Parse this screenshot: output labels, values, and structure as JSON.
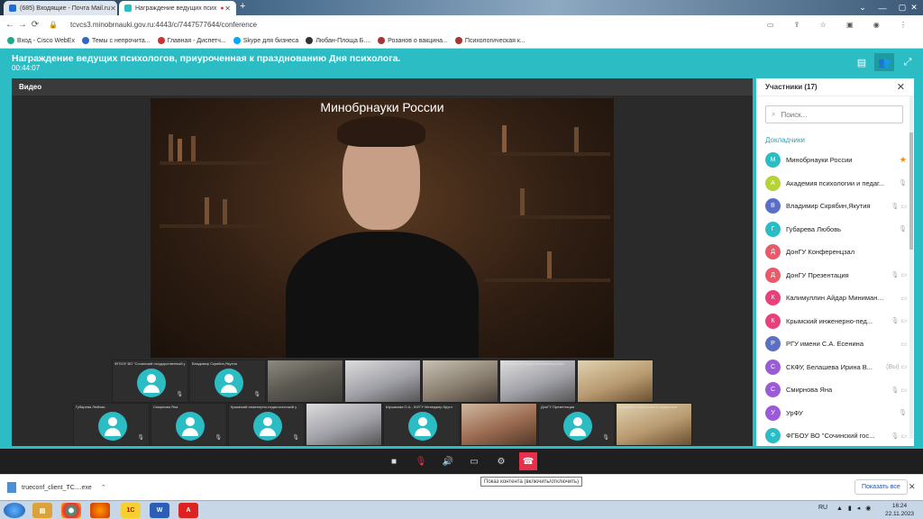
{
  "browser": {
    "tabs": [
      {
        "label": "(685) Входящие - Почта Mail.ru"
      },
      {
        "label": "Награждение ведущих псих"
      }
    ],
    "url": "tcvcs3.minobrnauki.gov.ru:4443/c/7447577644/conference",
    "bookmarks": [
      "Вход - Cisco WebEx",
      "Темы с непрочита...",
      "Главная - Диспетч...",
      "Skype для бизнеса",
      "Любан-Площа Б....",
      "Розанов о вакцина...",
      "Психологическая к..."
    ]
  },
  "conference": {
    "title": "Награждение ведущих психологов, приуроченная к празднованию Дня психолога.",
    "timer": "00:44:07",
    "video_label": "Видео",
    "speaker_title": "Минобрнауки России"
  },
  "tiles_row1": [
    {
      "caption": "ФГБОУ ВО \"Сочинский государственный у",
      "kind": "avatar"
    },
    {
      "caption": "Владимир Скрябин,Якутия",
      "kind": "avatar"
    },
    {
      "caption": "",
      "kind": "photo"
    },
    {
      "caption": "",
      "kind": "photo5"
    },
    {
      "caption": "",
      "kind": "photo2"
    },
    {
      "caption": "Калимуллин Айдар Минимансурович",
      "kind": "photo5"
    },
    {
      "caption": "",
      "kind": "photo4"
    },
    {
      "caption": "",
      "kind": "photo2"
    }
  ],
  "tiles_row2": [
    {
      "caption": "Губарева Любовь",
      "kind": "avatar"
    },
    {
      "caption": "Смирнова Яна",
      "kind": "avatar"
    },
    {
      "caption": "Крымский инженерно-педагогический у",
      "kind": "avatar"
    },
    {
      "caption": "",
      "kind": "photo5"
    },
    {
      "caption": "Шушакова О.А., ЮУГУ Менеджер Кругл",
      "kind": "avatar"
    },
    {
      "caption": "",
      "kind": "photo3"
    },
    {
      "caption": "ДонГУ Презентация",
      "kind": "avatar"
    },
    {
      "caption": "Академия психологии и педагогики",
      "kind": "photo4"
    }
  ],
  "participants": {
    "header": "Участники (17)",
    "search_placeholder": "Поиск...",
    "section": "Докладчики",
    "list": [
      {
        "letter": "М",
        "name": "Минобрнауки России",
        "color": "#2bbcc4",
        "icons": "★",
        "star": true
      },
      {
        "letter": "А",
        "name": "Академия психологии и педаг...",
        "color": "#b5d334",
        "icons": "🎙"
      },
      {
        "letter": "В",
        "name": "Владимир Скрябин,Якутия",
        "color": "#5b6fc7",
        "icons": "🎙 ▭"
      },
      {
        "letter": "Г",
        "name": "Губарева Любовь",
        "color": "#2bbcc4",
        "icons": "🎙"
      },
      {
        "letter": "Д",
        "name": "ДонГУ Конференцзал",
        "color": "#e85a6a",
        "icons": ""
      },
      {
        "letter": "Д",
        "name": "ДонГУ Презентация",
        "color": "#e85a6a",
        "icons": "🎙 ▭"
      },
      {
        "letter": "К",
        "name": "Калимуллин Айдар Миниманс...",
        "color": "#e8407a",
        "icons": "▭"
      },
      {
        "letter": "К",
        "name": "Крымский инженерно-пед...",
        "color": "#e8407a",
        "icons": "🎙 ▭"
      },
      {
        "letter": "Р",
        "name": "РГУ имени С.А. Есенина",
        "color": "#5b6fc7",
        "icons": "▭"
      },
      {
        "letter": "С",
        "name": "СКФУ, Белашева Ирина В...",
        "color": "#9c5bd6",
        "icons": "(Вы) ▭"
      },
      {
        "letter": "С",
        "name": "Смирнова Яна",
        "color": "#9c5bd6",
        "icons": "🎙 ▭"
      },
      {
        "letter": "У",
        "name": "УрФУ",
        "color": "#9c5bd6",
        "icons": "🎙"
      },
      {
        "letter": "Ф",
        "name": "ФГБОУ ВО \"Сочинский гос...",
        "color": "#2bbcc4",
        "icons": "🎙 ▭"
      }
    ]
  },
  "toolbar": {
    "tooltip": "Показ контента (включить/отключить)"
  },
  "download": {
    "file": "trueconf_client_TC....exe",
    "show_all": "Показать все"
  },
  "taskbar": {
    "lang": "RU",
    "time": "16:24",
    "date": "22.11.2023"
  }
}
